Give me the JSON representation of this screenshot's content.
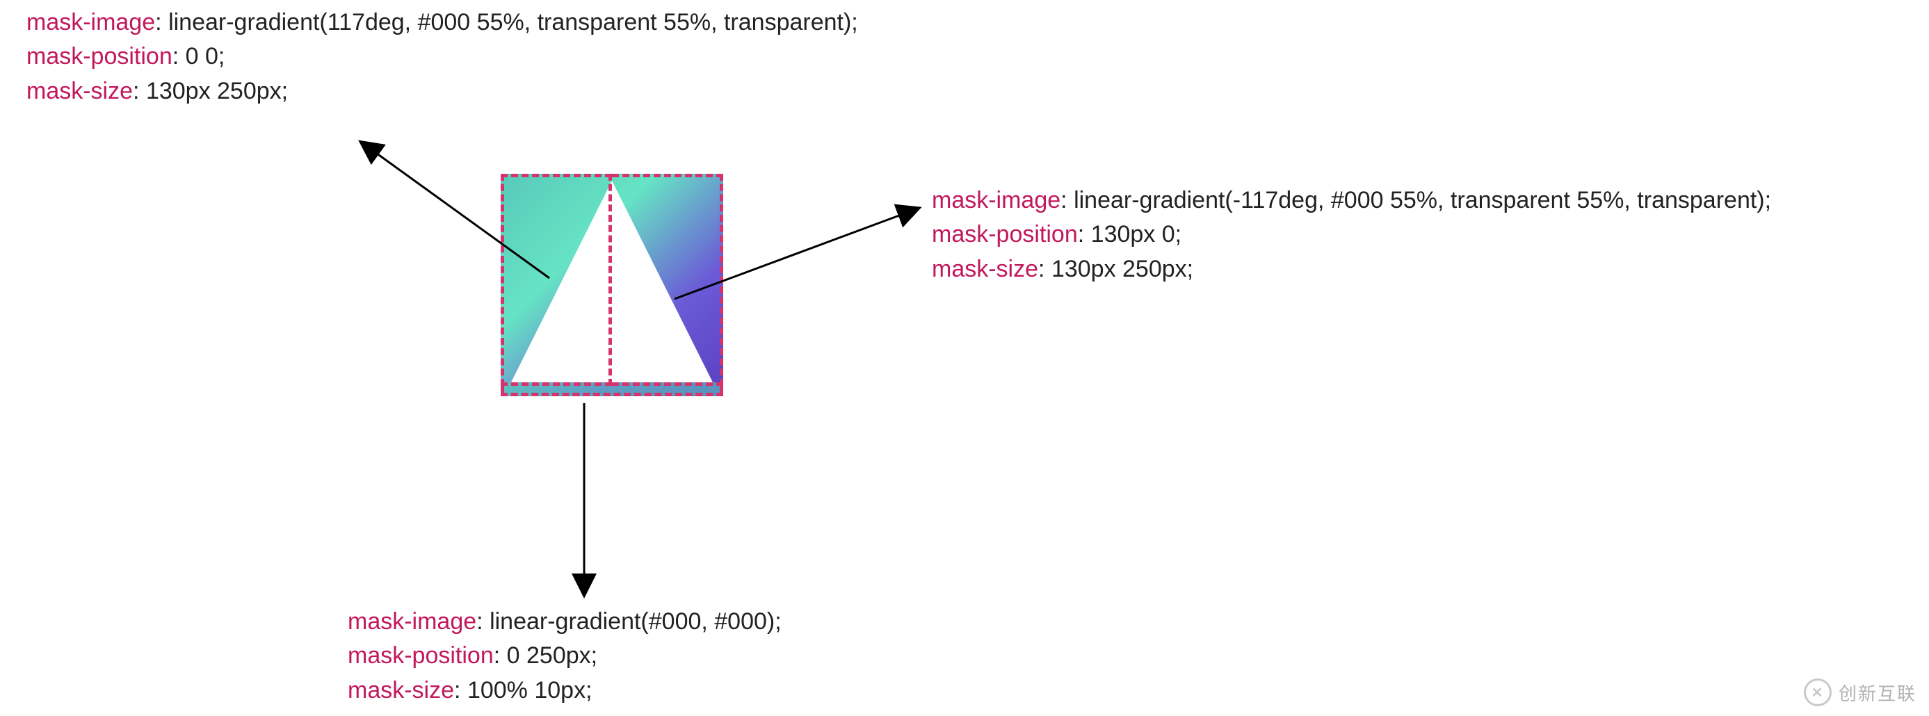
{
  "topLeft": {
    "p1": "mask-image",
    "v1": "linear-gradient(117deg, #000 55%, transparent 55%, transparent);",
    "p2": "mask-position",
    "v2": "0 0;",
    "p3": "mask-size",
    "v3": "130px 250px;"
  },
  "topRight": {
    "p1": "mask-image",
    "v1": "linear-gradient(-117deg, #000 55%, transparent 55%, transparent);",
    "p2": "mask-position",
    "v2": "130px 0;",
    "p3": "mask-size",
    "v3": "130px 250px;"
  },
  "bottom": {
    "p1": "mask-image",
    "v1": "linear-gradient(#000, #000);",
    "p2": "mask-position",
    "v2": "0 250px;",
    "p3": "mask-size",
    "v3": "100% 10px;"
  },
  "watermark": {
    "text": "创新互联"
  },
  "diagram": {
    "description": "A square with a gradient fill and a white triangle cutout, subdivided by dashed rectangles into left-half, right-half, and a thin bottom strip. Arrows point from each dashed region to the corresponding CSS mask rule."
  }
}
